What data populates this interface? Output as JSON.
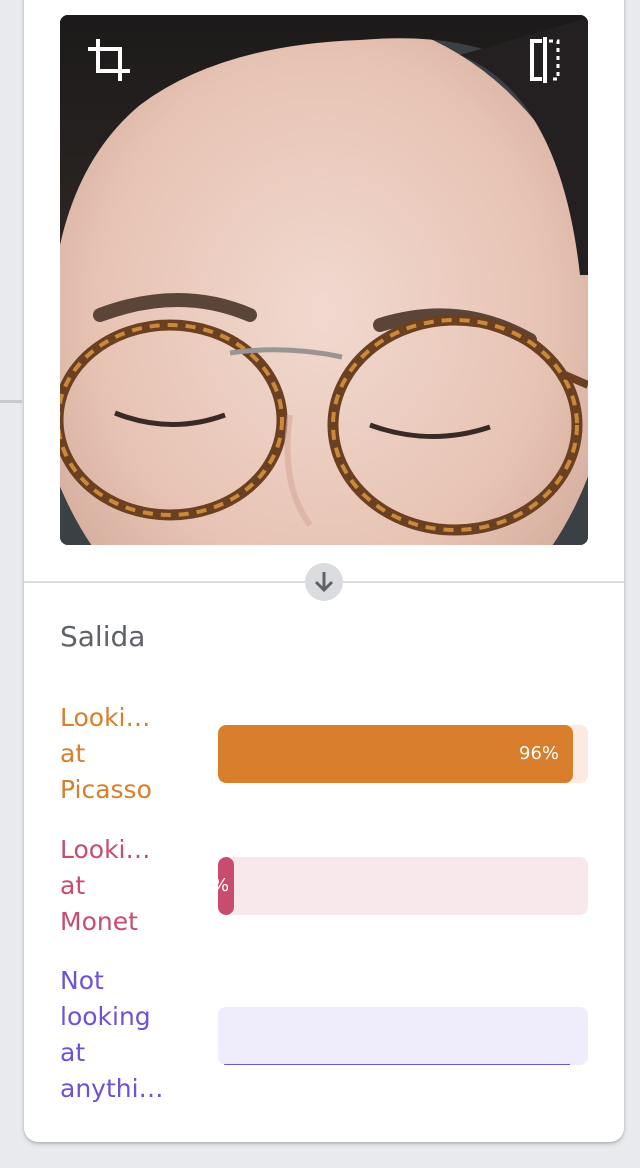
{
  "webcam": {
    "crop_icon": "crop-icon",
    "mirror_icon": "flip-horizontal-icon"
  },
  "divider_button_icon": "arrow-down-icon",
  "output": {
    "title": "Salida",
    "classes": [
      {
        "label_lines": [
          "Looki…",
          "at",
          "Picasso"
        ],
        "value_text": "96%",
        "value": 0.96,
        "color": "#d97e2c",
        "track_color": "#fbeadf"
      },
      {
        "label_lines": [
          "Looki…",
          "at",
          "Monet"
        ],
        "value_text": "%",
        "value": 0.04,
        "color": "#c94c6e",
        "track_color": "#f9e8eb"
      },
      {
        "label_lines": [
          "Not",
          "looking",
          "at",
          "anythi…"
        ],
        "value_text": "",
        "value": 0.0,
        "color": "#6f52d8",
        "track_color": "#efedfc"
      }
    ]
  }
}
